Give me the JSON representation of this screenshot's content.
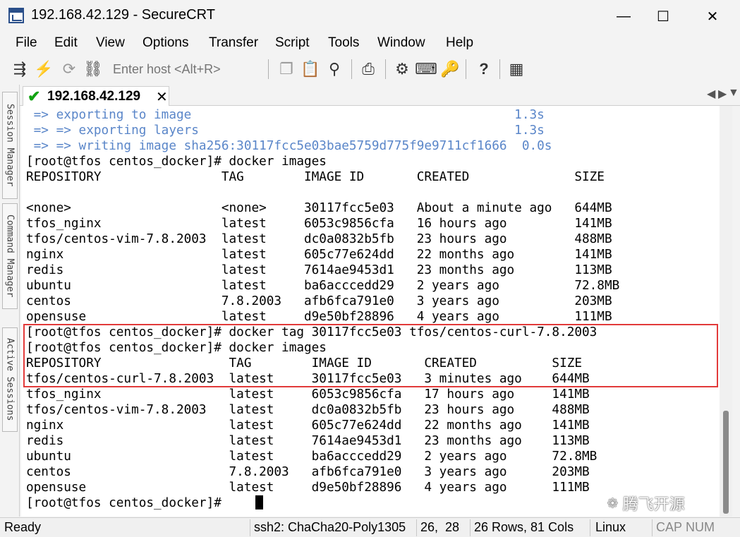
{
  "window": {
    "title": "192.168.42.129 - SecureCRT",
    "minimize": "—",
    "maximize": "☐",
    "close": "✕"
  },
  "menu": [
    "File",
    "Edit",
    "View",
    "Options",
    "Transfer",
    "Script",
    "Tools",
    "Window",
    "Help"
  ],
  "toolbar": {
    "host_placeholder": "Enter host <Alt+R>"
  },
  "tab": {
    "label": "192.168.42.129",
    "close": "✕",
    "prev": "◀",
    "next": "▶",
    "list": "▼"
  },
  "side_panels": [
    "Session Manager",
    "Command Manager",
    "Active Sessions"
  ],
  "terminal": {
    "lines": [
      " => exporting to image                                           1.3s",
      " => => exporting layers                                          1.3s",
      " => => writing image sha256:30117fcc5e03bae5759d775f9e9711cf1666  0.0s",
      "[root@tfos centos_docker]# docker images",
      "REPOSITORY                TAG        IMAGE ID       CREATED              SIZE",
      "",
      "<none>                    <none>     30117fcc5e03   About a minute ago   644MB",
      "tfos_nginx                latest     6053c9856cfa   16 hours ago         141MB",
      "tfos/centos-vim-7.8.2003  latest     dc0a0832b5fb   23 hours ago         488MB",
      "nginx                     latest     605c77e624dd   22 months ago        141MB",
      "redis                     latest     7614ae9453d1   23 months ago        113MB",
      "ubuntu                    latest     ba6acccedd29   2 years ago          72.8MB",
      "centos                    7.8.2003   afb6fca791e0   3 years ago          203MB",
      "opensuse                  latest     d9e50bf28896   4 years ago          111MB",
      "[root@tfos centos_docker]# docker tag 30117fcc5e03 tfos/centos-curl-7.8.2003",
      "[root@tfos centos_docker]# docker images",
      "REPOSITORY                 TAG        IMAGE ID       CREATED          SIZE",
      "tfos/centos-curl-7.8.2003  latest     30117fcc5e03   3 minutes ago    644MB",
      "tfos_nginx                 latest     6053c9856cfa   17 hours ago     141MB",
      "tfos/centos-vim-7.8.2003   latest     dc0a0832b5fb   23 hours ago     488MB",
      "nginx                      latest     605c77e624dd   22 months ago    141MB",
      "redis                      latest     7614ae9453d1   23 months ago    113MB",
      "ubuntu                     latest     ba6acccedd29   2 years ago      72.8MB",
      "centos                     7.8.2003   afb6fca791e0   3 years ago      203MB",
      "opensuse                   latest     d9e50bf28896   4 years ago      111MB",
      "[root@tfos centos_docker]# "
    ]
  },
  "watermark": "腾飞开源",
  "status": {
    "ready": "Ready",
    "protocol": "ssh2: ChaCha20-Poly1305",
    "position": "26,  28",
    "size": "26 Rows, 81 Cols",
    "os": "Linux",
    "cap": "CAP",
    "num": "NUM"
  },
  "colors": {
    "progress_text": "#5a86c9",
    "highlight_border": "#e23a3a",
    "connected_check": "#12a312"
  }
}
